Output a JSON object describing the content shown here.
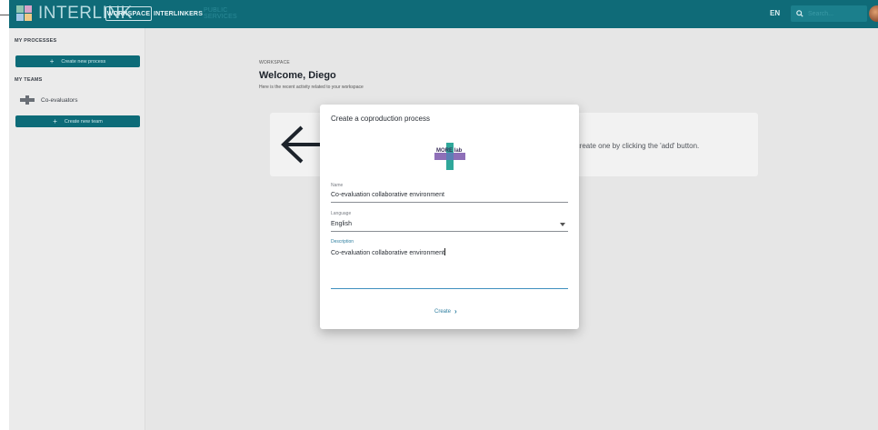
{
  "app": {
    "logo_text": "INTERLINK",
    "nav": {
      "workspace": "WORKSPACE",
      "interlinkers": "INTERLINKERS",
      "public_services": "PUBLIC SERVICES"
    },
    "language": "EN",
    "search_placeholder": "Search..."
  },
  "sidebar": {
    "my_processes_heading": "MY PROCESSES",
    "create_process_label": "Create new process",
    "my_teams_heading": "MY TEAMS",
    "team_name": "Co-evaluators",
    "create_team_label": "Create new team"
  },
  "workspace": {
    "label": "WORKSPACE",
    "title": "Welcome, Diego",
    "subtitle": "Here is the recent activity related to your workspace",
    "empty_text": "n create one by clicking the 'add' button."
  },
  "modal": {
    "title": "Create a coproduction process",
    "logo_text": "MORE lab",
    "name_label": "Name",
    "name_value": "Co-evaluation collaborative environment",
    "language_label": "Language",
    "language_value": "English",
    "description_label": "Description",
    "description_value": "Co-evaluation collaborative environment",
    "create_label": "Create"
  },
  "colors": {
    "topbar": "#0f6b78",
    "sidebar_button": "#0d6b78",
    "accent": "#2f7fa0",
    "backdrop": "#e6e6e6"
  }
}
